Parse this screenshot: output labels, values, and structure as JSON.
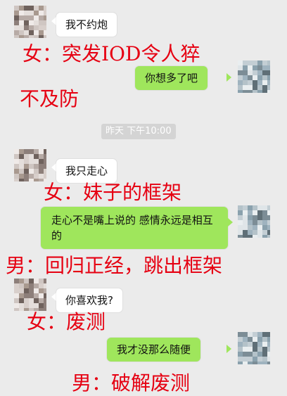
{
  "colors": {
    "background": "#ebebeb",
    "bubble_self": "#9fe65c",
    "bubble_other": "#ffffff",
    "annotation": "#e60012"
  },
  "chat": {
    "timestamp": "昨天 下午10:00",
    "messages": [
      {
        "side": "left",
        "text": "我不约炮"
      },
      {
        "side": "right",
        "text": "你想多了吧"
      },
      {
        "side": "left",
        "text": "我只走心"
      },
      {
        "side": "right",
        "text": "走心不是嘴上说的 感情永远是相互的"
      },
      {
        "side": "left",
        "text": "你喜欢我?"
      },
      {
        "side": "right",
        "text": "我才没那么随便"
      }
    ]
  },
  "annotations": [
    "女：突发IOD令人猝",
    "不及防",
    "女：妹子的框架",
    "男：回归正经，跳出框架",
    "女：废测",
    "男：破解废测"
  ]
}
